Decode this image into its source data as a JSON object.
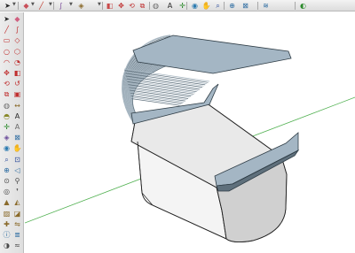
{
  "top_toolbar": {
    "items": [
      {
        "icon": "select-arrow-icon",
        "glyph": "➤",
        "color": "#222222"
      },
      {
        "icon": "eraser-icon",
        "glyph": "◆",
        "color": "#c9505a"
      },
      {
        "icon": "pencil-line-icon",
        "glyph": "╱",
        "color": "#c0392b"
      },
      {
        "icon": "freehand-icon",
        "glyph": "∫",
        "color": "#7a4a9a"
      },
      {
        "icon": "paint-bucket-icon",
        "glyph": "◈",
        "color": "#8a6a2a"
      },
      {
        "icon": "push-pull-icon",
        "glyph": "◧",
        "color": "#c94a4a"
      },
      {
        "icon": "move-icon",
        "glyph": "✥",
        "color": "#c03030"
      },
      {
        "icon": "rotate-icon",
        "glyph": "⟲",
        "color": "#c03030"
      },
      {
        "icon": "scale-icon",
        "glyph": "⧉",
        "color": "#c03030"
      },
      {
        "icon": "tape-measure-icon",
        "glyph": "◍",
        "color": "#6a6a6a"
      },
      {
        "icon": "text-icon",
        "glyph": "A",
        "color": "#2a2a2a"
      },
      {
        "icon": "axes-icon",
        "glyph": "✛",
        "color": "#2a8a2a"
      },
      {
        "icon": "orbit-icon",
        "glyph": "◉",
        "color": "#2a7ab0"
      },
      {
        "icon": "pan-icon",
        "glyph": "✋",
        "color": "#2a7ab0"
      },
      {
        "icon": "zoom-icon",
        "glyph": "⌕",
        "color": "#2a4a9a"
      },
      {
        "icon": "zoom-extents-icon",
        "glyph": "⊕",
        "color": "#2a6aa0"
      },
      {
        "icon": "section-plane-icon",
        "glyph": "⊠",
        "color": "#2a6aa0"
      },
      {
        "icon": "layers-icon",
        "glyph": "≋",
        "color": "#2a6aa0"
      },
      {
        "icon": "warehouse-icon",
        "glyph": "◐",
        "color": "#2a8a2a"
      }
    ]
  },
  "left_palette": {
    "rows": [
      [
        {
          "icon": "select-icon",
          "glyph": "➤",
          "color": "#222222"
        },
        {
          "icon": "eraser-icon",
          "glyph": "◆",
          "color": "#d06080"
        }
      ],
      [
        {
          "icon": "line-icon",
          "glyph": "╱",
          "color": "#c03030"
        },
        {
          "icon": "freehand-icon",
          "glyph": "∫",
          "color": "#c03030"
        }
      ],
      [
        {
          "icon": "rectangle-icon",
          "glyph": "▭",
          "color": "#c03030"
        },
        {
          "icon": "rotated-rectangle-icon",
          "glyph": "◇",
          "color": "#c03030"
        }
      ],
      [
        {
          "icon": "circle-icon",
          "glyph": "○",
          "color": "#c03030"
        },
        {
          "icon": "polygon-icon",
          "glyph": "⬡",
          "color": "#c03030"
        }
      ],
      [
        {
          "icon": "arc-icon",
          "glyph": "◠",
          "color": "#c03030"
        },
        {
          "icon": "pie-icon",
          "glyph": "◔",
          "color": "#c03030"
        }
      ],
      [
        {
          "icon": "move-icon",
          "glyph": "✥",
          "color": "#c03030"
        },
        {
          "icon": "push-pull-icon",
          "glyph": "◧",
          "color": "#c03030"
        }
      ],
      [
        {
          "icon": "rotate-icon",
          "glyph": "⟲",
          "color": "#c03030"
        },
        {
          "icon": "follow-me-icon",
          "glyph": "↺",
          "color": "#c03030"
        }
      ],
      [
        {
          "icon": "scale-icon",
          "glyph": "⧉",
          "color": "#c03030"
        },
        {
          "icon": "offset-icon",
          "glyph": "▣",
          "color": "#c03030"
        }
      ],
      [
        {
          "icon": "tape-measure-icon",
          "glyph": "◍",
          "color": "#6a6a6a"
        },
        {
          "icon": "dimension-icon",
          "glyph": "↔",
          "color": "#8a6a2a"
        }
      ],
      [
        {
          "icon": "protractor-icon",
          "glyph": "◓",
          "color": "#8a8a2a"
        },
        {
          "icon": "text-icon",
          "glyph": "A",
          "color": "#2a2a2a"
        }
      ],
      [
        {
          "icon": "axes-icon",
          "glyph": "✛",
          "color": "#2a8a2a"
        },
        {
          "icon": "3d-text-icon",
          "glyph": "A",
          "color": "#6a6a6a"
        }
      ],
      [
        {
          "icon": "paint-bucket-icon",
          "glyph": "◈",
          "color": "#6a4a9a"
        },
        {
          "icon": "section-plane-icon",
          "glyph": "⊠",
          "color": "#2a6aa0"
        }
      ],
      [
        {
          "icon": "orbit-icon",
          "glyph": "◉",
          "color": "#2a7ab0"
        },
        {
          "icon": "pan-icon",
          "glyph": "✋",
          "color": "#2a7ab0"
        }
      ],
      [
        {
          "icon": "zoom-icon",
          "glyph": "⌕",
          "color": "#2a4a9a"
        },
        {
          "icon": "zoom-window-icon",
          "glyph": "⊡",
          "color": "#2a4a9a"
        }
      ],
      [
        {
          "icon": "zoom-extents-icon",
          "glyph": "⊕",
          "color": "#2a6aa0"
        },
        {
          "icon": "previous-view-icon",
          "glyph": "◁",
          "color": "#2a6aa0"
        }
      ],
      [
        {
          "icon": "position-camera-icon",
          "glyph": "⊙",
          "color": "#4a4a4a"
        },
        {
          "icon": "walk-icon",
          "glyph": "⚲",
          "color": "#4a4a4a"
        }
      ],
      [
        {
          "icon": "look-around-icon",
          "glyph": "◎",
          "color": "#4a4a4a"
        },
        {
          "icon": "footprints-icon",
          "glyph": "❜",
          "color": "#4a4a4a"
        }
      ],
      [
        {
          "icon": "sandbox-icon",
          "glyph": "▲",
          "color": "#8a6a2a"
        },
        {
          "icon": "smoove-icon",
          "glyph": "◭",
          "color": "#8a6a2a"
        }
      ],
      [
        {
          "icon": "stamp-icon",
          "glyph": "▨",
          "color": "#8a6a2a"
        },
        {
          "icon": "drape-icon",
          "glyph": "◪",
          "color": "#8a6a2a"
        }
      ],
      [
        {
          "icon": "add-detail-icon",
          "glyph": "✚",
          "color": "#8a6a2a"
        },
        {
          "icon": "flip-edge-icon",
          "glyph": "⇋",
          "color": "#8a6a2a"
        }
      ],
      [
        {
          "icon": "model-info-icon",
          "glyph": "ⓘ",
          "color": "#2a6aa0"
        },
        {
          "icon": "outliner-icon",
          "glyph": "≣",
          "color": "#2a6aa0"
        }
      ],
      [
        {
          "icon": "shadows-icon",
          "glyph": "◑",
          "color": "#4a4a4a"
        },
        {
          "icon": "fog-icon",
          "glyph": "≈",
          "color": "#4a4a4a"
        }
      ]
    ]
  },
  "viewport": {
    "background": "#ffffff",
    "axis_green": "#4fb04f",
    "model": {
      "base_front": "#f4f4f4",
      "base_side": "#d0d0d0",
      "base_top": "#e9e9e9",
      "slats": "#a9b8c3",
      "slat_dark": "#5f707c",
      "tray": "#a4b6c4"
    }
  }
}
